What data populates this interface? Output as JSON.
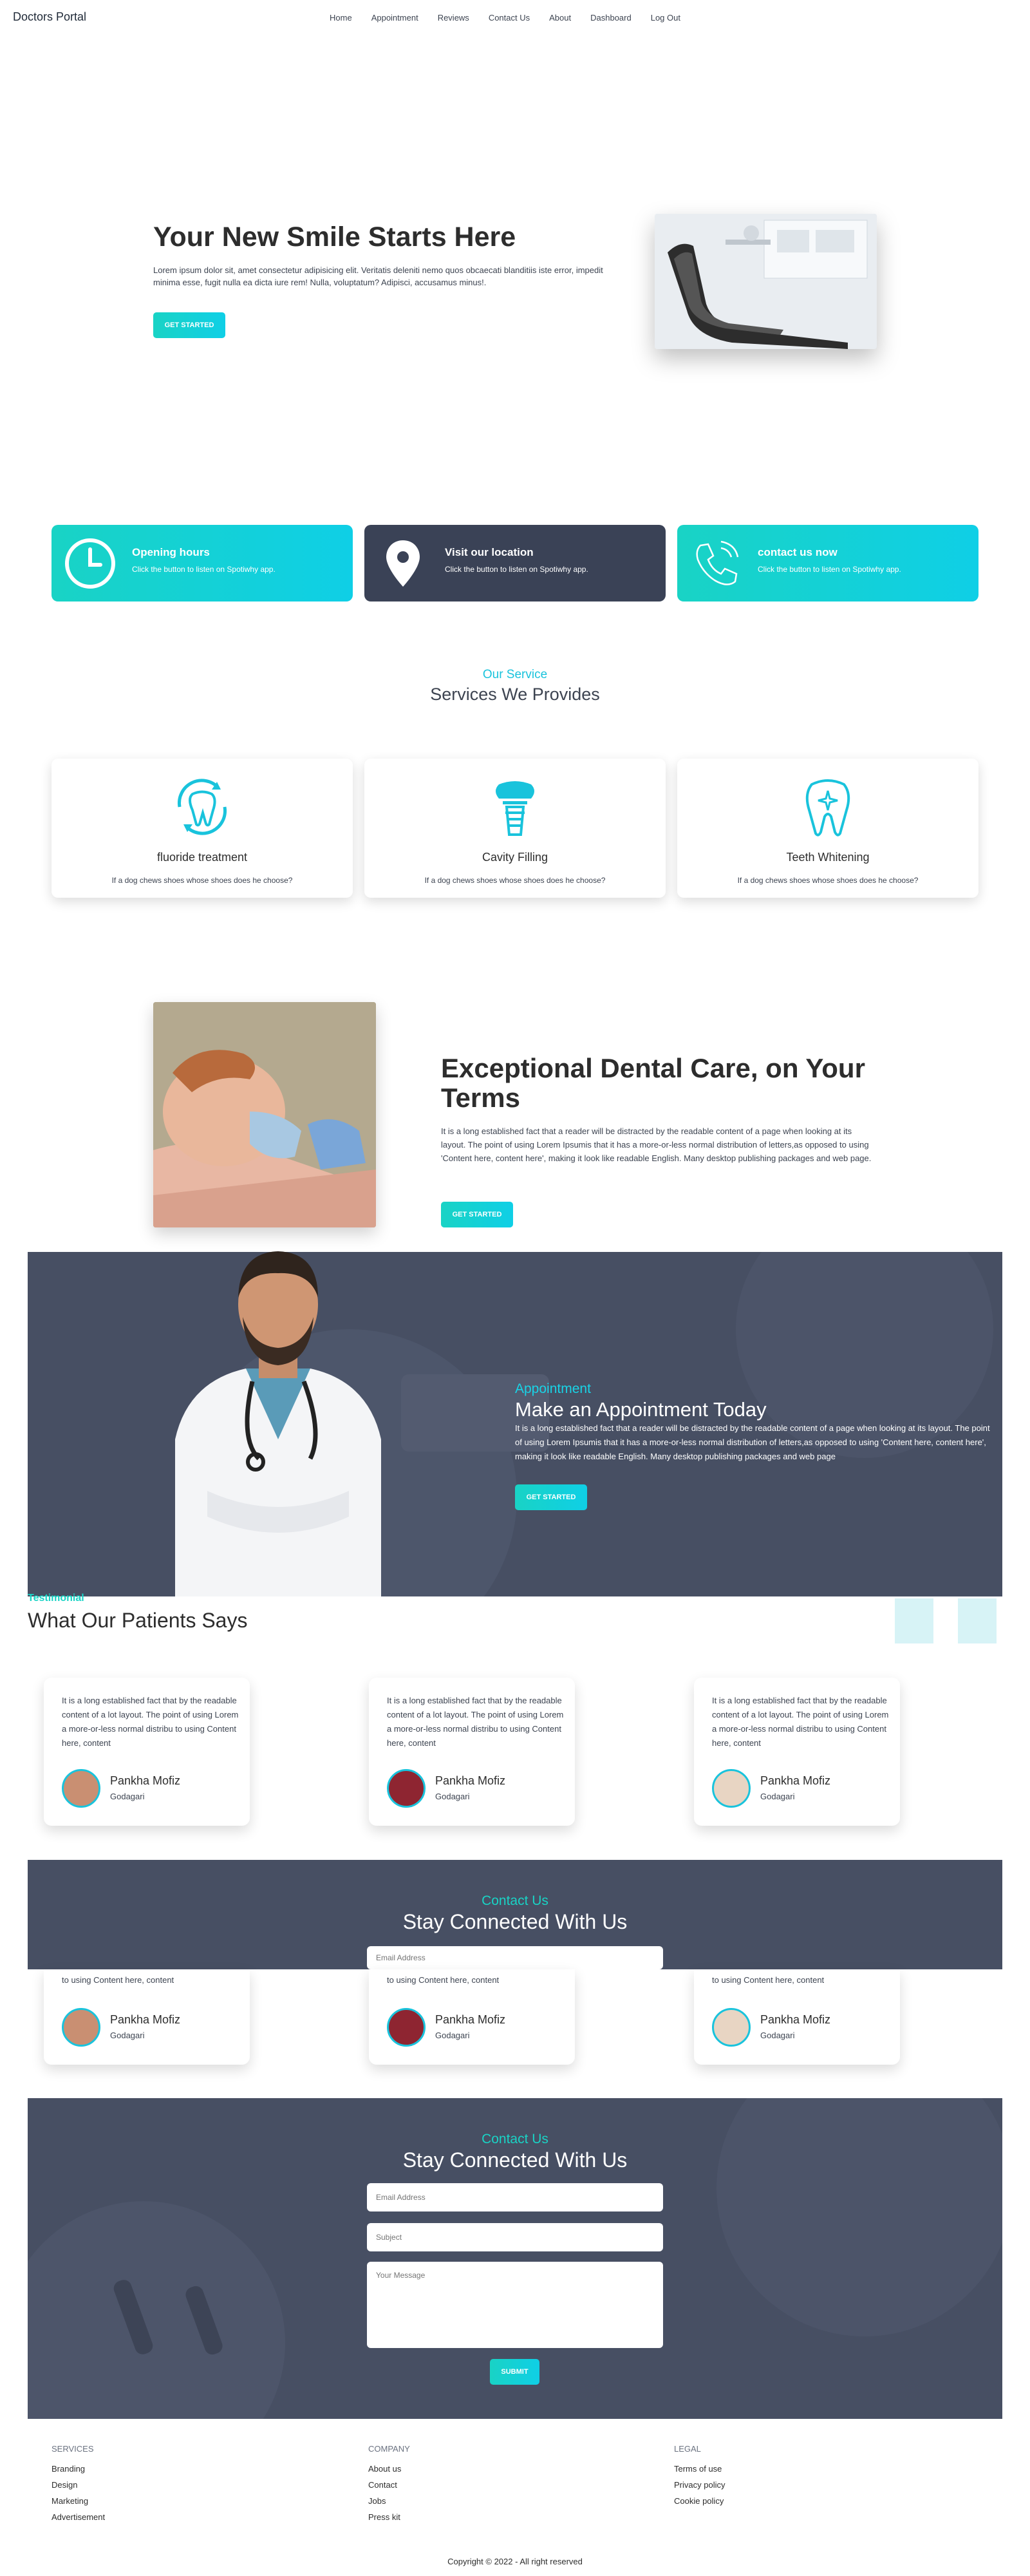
{
  "nav": {
    "brand": "Doctors Portal",
    "items": [
      "Home",
      "Appointment",
      "Reviews",
      "Contact Us",
      "About",
      "Dashboard",
      "Log Out"
    ]
  },
  "hero": {
    "title": "Your New Smile Starts Here",
    "text": "Lorem ipsum dolor sit, amet consectetur adipisicing elit. Veritatis deleniti nemo quos obcaecati blanditiis iste error, impedit minima esse, fugit nulla ea dicta iure rem! Nulla, voluptatum? Adipisci, accusamus minus!.",
    "button": "GET STARTED"
  },
  "info_cards": [
    {
      "title": "Opening hours",
      "text": "Click the button to listen on Spotiwhy app.",
      "icon": "clock-icon"
    },
    {
      "title": "Visit our location",
      "text": "Click the button to listen on Spotiwhy app.",
      "icon": "location-pin-icon"
    },
    {
      "title": "contact us now",
      "text": "Click the button to listen on Spotiwhy app.",
      "icon": "phone-icon"
    }
  ],
  "services": {
    "subtitle": "Our Service",
    "title": "Services We Provides",
    "items": [
      {
        "name": "fluoride treatment",
        "desc": "If a dog chews shoes whose shoes does he choose?",
        "icon": "tooth-arrows-icon"
      },
      {
        "name": "Cavity Filling",
        "desc": "If a dog chews shoes whose shoes does he choose?",
        "icon": "tooth-implant-icon"
      },
      {
        "name": "Teeth Whitening",
        "desc": "If a dog chews shoes whose shoes does he choose?",
        "icon": "tooth-sparkle-icon"
      }
    ]
  },
  "care": {
    "title": "Exceptional Dental Care, on Your Terms",
    "text": "It is a long established fact that a reader will be distracted by the readable content of a page when looking at its layout. The point of using Lorem Ipsumis that it has a more-or-less normal distribution of letters,as opposed to using 'Content here, content here', making it look like readable English. Many desktop publishing packages and web page.",
    "button": "GET STARTED"
  },
  "appointment": {
    "subtitle": "Appointment",
    "title": "Make an Appointment Today",
    "text": "It is a long established fact that a reader will be distracted by the readable content of a page when looking at its layout. The point of using Lorem Ipsumis that it has a more-or-less normal distribution of letters,as opposed to using 'Content here, content here', making it look like readable English. Many desktop publishing packages and web page",
    "button": "GET STARTED"
  },
  "testimonials": {
    "subtitle": "Testimonial",
    "title": "What Our Patients Says",
    "text": "It is a long established fact that by the readable content of a lot layout. The point of using Lorem a more-or-less normal distribu to using Content here, content",
    "text_clipped": "to using Content here, content",
    "items": [
      {
        "name": "Pankha Mofiz",
        "location": "Godagari"
      },
      {
        "name": "Pankha Mofiz",
        "location": "Godagari"
      },
      {
        "name": "Pankha Mofiz",
        "location": "Godagari"
      }
    ]
  },
  "contact": {
    "subtitle": "Contact Us",
    "title": "Stay Connected With Us",
    "email_placeholder": "Email Address",
    "subject_placeholder": "Subject",
    "message_placeholder": "Your Message",
    "submit": "SUBMIT"
  },
  "footer": {
    "columns": [
      {
        "heading": "SERVICES",
        "links": [
          "Branding",
          "Design",
          "Marketing",
          "Advertisement"
        ]
      },
      {
        "heading": "COMPANY",
        "links": [
          "About us",
          "Contact",
          "Jobs",
          "Press kit"
        ]
      },
      {
        "heading": "LEGAL",
        "links": [
          "Terms of use",
          "Privacy policy",
          "Cookie policy"
        ]
      }
    ],
    "copyright": "Copyright © 2022 - All right reserved"
  },
  "colors": {
    "teal": "#19d3c5",
    "cyan": "#0fcfe6",
    "dark": "#3a4256",
    "text": "#3d4451"
  }
}
